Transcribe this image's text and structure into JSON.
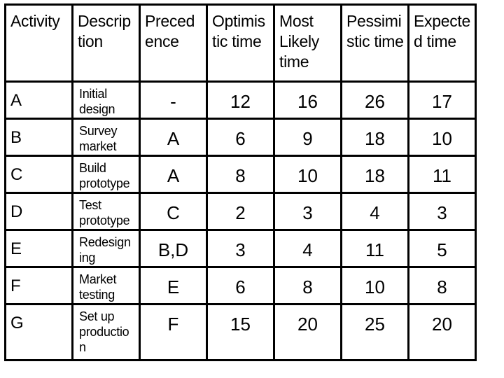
{
  "table": {
    "headers": [
      "Activity",
      "Descrip\ntion",
      "Preced\nence",
      "Optimis\ntic time",
      "Most\nLikely\ntime",
      "Pessimi\nstic time",
      "Expecte\nd time"
    ],
    "rows": [
      {
        "activity": "A",
        "description": "Initial\ndesign",
        "precedence": "-",
        "optimistic": "12",
        "most_likely": "16",
        "pessimistic": "26",
        "expected": "17"
      },
      {
        "activity": "B",
        "description": "Survey\nmarket",
        "precedence": "A",
        "optimistic": "6",
        "most_likely": "9",
        "pessimistic": "18",
        "expected": "10"
      },
      {
        "activity": "C",
        "description": "Build\nprototype",
        "precedence": "A",
        "optimistic": "8",
        "most_likely": "10",
        "pessimistic": "18",
        "expected": "11"
      },
      {
        "activity": "D",
        "description": "Test\nprototype",
        "precedence": "C",
        "optimistic": "2",
        "most_likely": "3",
        "pessimistic": "4",
        "expected": "3"
      },
      {
        "activity": "E",
        "description": "Redesign\ning",
        "precedence": "B,D",
        "optimistic": "3",
        "most_likely": "4",
        "pessimistic": "11",
        "expected": "5"
      },
      {
        "activity": "F",
        "description": "Market\ntesting",
        "precedence": "E",
        "optimistic": "6",
        "most_likely": "8",
        "pessimistic": "10",
        "expected": "8"
      },
      {
        "activity": "G",
        "description": "Set up\nproductio\nn",
        "precedence": "F",
        "optimistic": "15",
        "most_likely": "20",
        "pessimistic": "25",
        "expected": "20"
      }
    ]
  }
}
